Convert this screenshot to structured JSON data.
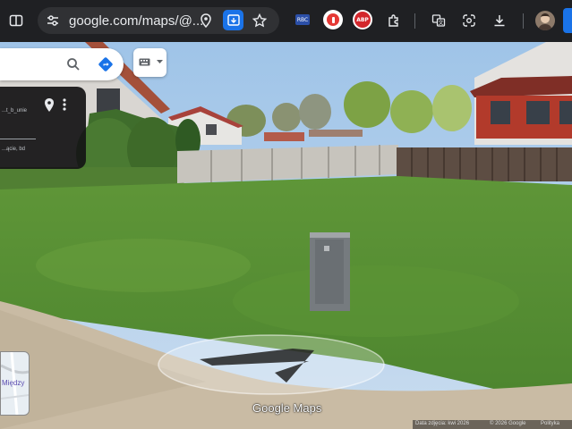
{
  "browser": {
    "url": "google.com/maps/@...",
    "icons": {
      "site_info": "tune-icon",
      "split": "split-view-icon",
      "location": "location-pin-icon",
      "install": "install-app-icon",
      "bookmark": "star-icon",
      "extensions": "puzzle-icon",
      "translate": "translate-icon",
      "lens": "google-lens-icon",
      "download": "download-icon",
      "profile": "avatar"
    },
    "ext_badge_text": "RBC",
    "abp_text": "ABP"
  },
  "maps": {
    "search_icon": "search-icon",
    "directions_icon": "directions-icon",
    "keyboard_icon": "keyboard-icon",
    "card": {
      "line1": "...t_b_unie",
      "line2": "...ącie, bd"
    },
    "minimap_label": "Między",
    "logo": "Google Maps",
    "footer": {
      "date": "Data zdjęcia: kwi 2026",
      "copyright": "© 2026 Google",
      "policy": "Polityka"
    }
  },
  "colors": {
    "toolbar_bg": "#1f2023",
    "omnibox_bg": "#303134",
    "directions_blue": "#1a73e8",
    "record_red": "#e53935",
    "abp_red": "#d3272c"
  }
}
